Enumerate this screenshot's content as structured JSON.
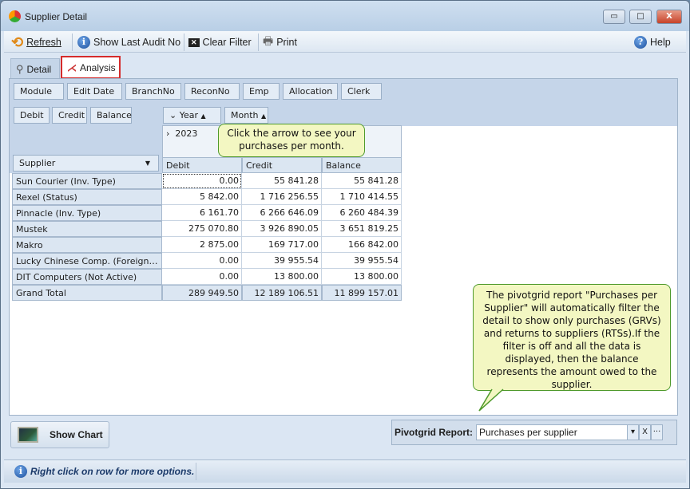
{
  "window": {
    "title": "Supplier Detail",
    "minimize": "▭",
    "maximize": "□",
    "close": "X"
  },
  "toolbar": {
    "refresh": "Refresh",
    "show_last_audit": "Show Last Audit No",
    "clear_filter": "Clear Filter",
    "print": "Print",
    "help": "Help"
  },
  "tabs": [
    {
      "label": "Detail",
      "active": false
    },
    {
      "label": "Analysis",
      "active": true
    }
  ],
  "filter_fields": [
    "Module",
    "Edit Date",
    "BranchNo",
    "ReconNo",
    "Emp",
    "Allocation",
    "Clerk"
  ],
  "data_fields": [
    "Debit",
    "Credit",
    "Balance"
  ],
  "column_fields": [
    {
      "label": "Year",
      "sort": "▲",
      "expand": "⌄"
    },
    {
      "label": "Month",
      "sort": "▲"
    }
  ],
  "row_field": {
    "label": "Supplier",
    "dropdown": "▼"
  },
  "pivot": {
    "year": "2023",
    "expander": "›",
    "columns": [
      "Debit",
      "Credit",
      "Balance"
    ],
    "rows": [
      {
        "label": "Sun Courier (Inv. Type)",
        "debit": "0.00",
        "credit": "55 841.28",
        "balance": "55 841.28"
      },
      {
        "label": "Rexel (Status)",
        "debit": "5 842.00",
        "credit": "1 716 256.55",
        "balance": "1 710 414.55"
      },
      {
        "label": "Pinnacle (Inv. Type)",
        "debit": "6 161.70",
        "credit": "6 266 646.09",
        "balance": "6 260 484.39"
      },
      {
        "label": "Mustek",
        "debit": "275 070.80",
        "credit": "3 926 890.05",
        "balance": "3 651 819.25"
      },
      {
        "label": "Makro",
        "debit": "2 875.00",
        "credit": "169 717.00",
        "balance": "166 842.00"
      },
      {
        "label": "Lucky Chinese Comp. (Foreign Imp...",
        "debit": "0.00",
        "credit": "39 955.54",
        "balance": "39 955.54"
      },
      {
        "label": "DIT Computers (Not Active)",
        "debit": "0.00",
        "credit": "13 800.00",
        "balance": "13 800.00"
      }
    ],
    "total": {
      "label": "Grand Total",
      "debit": "289 949.50",
      "credit": "12 189 106.51",
      "balance": "11 899 157.01"
    }
  },
  "callouts": {
    "year": "Click the arrow to see your purchases per month.",
    "report": "The pivotgrid report \"Purchases per Supplier\" will automatically filter the detail to show only purchases (GRVs) and returns to suppliers (RTSs).If the filter is off and all the data is displayed, then the balance represents the amount owed to the supplier."
  },
  "bottom": {
    "show_chart": "Show Chart",
    "pivot_label": "Pivotgrid Report:",
    "pivot_value": "Purchases per supplier",
    "dropdown": "▾",
    "clear": "X",
    "more": "···"
  },
  "status": {
    "text": "Right click on row for more options."
  }
}
